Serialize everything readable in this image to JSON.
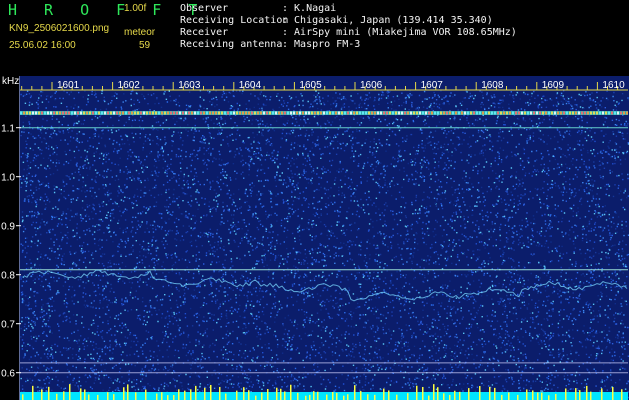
{
  "header": {
    "brand": "H R O F F T",
    "version": "1.00f",
    "filename": "KN9_2506021600.png",
    "unit": "meteor",
    "datetime": "25.06.02 16:00",
    "count": "59"
  },
  "info": [
    {
      "label": "Observer",
      "value": ": K.Nagai"
    },
    {
      "label": "Receiving Location",
      "value": ": Chigasaki, Japan (139.414 35.340)"
    },
    {
      "label": "Receiver",
      "value": ": AirSpy mini (Miakejima VOR 108.65MHz)"
    },
    {
      "label": "Receiving antenna",
      "value": ": Maspro FM-3"
    }
  ],
  "colors": {
    "background": "#000000",
    "plot_bg": "#0b1d6b",
    "brand": "#2ee85a",
    "header_text": "#e6d94a",
    "info_text": "#f4f4f4",
    "axis": "#e6d94a",
    "baseline": "#00e5ff",
    "echo_line": "#6fe3d6",
    "spike": "#ffff40"
  },
  "chart_data": {
    "type": "heatmap",
    "y_unit_label": "kHz",
    "x_ticks": [
      "1601",
      "1602",
      "1603",
      "1604",
      "1605",
      "1606",
      "1607",
      "1608",
      "1609",
      "1610"
    ],
    "y_ticks": [
      "1.1",
      "1.0",
      "0.9",
      "0.8",
      "0.7",
      "0.6"
    ],
    "ylim": [
      0.585,
      1.175
    ],
    "x_range_minutes": [
      1600,
      1610
    ],
    "constant_lines_khz": [
      1.13,
      1.1,
      0.81,
      0.62,
      0.6
    ]
  }
}
